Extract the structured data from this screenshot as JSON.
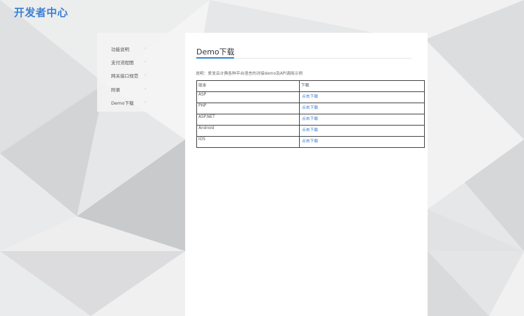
{
  "brand": {
    "title": "开发者中心"
  },
  "sidebar": {
    "items": [
      {
        "label": "功能说明",
        "chevron": "›"
      },
      {
        "label": "支付流程图",
        "chevron": "›"
      },
      {
        "label": "网关接口规范",
        "chevron": "›"
      },
      {
        "label": "附录",
        "chevron": "›"
      },
      {
        "label": "Demo下载",
        "chevron": "›"
      }
    ]
  },
  "main": {
    "title": "Demo下载",
    "description": "说明：爱发云计费各种平台语言的对接demo及API调用示例",
    "table": {
      "headers": [
        "版本",
        "下载"
      ],
      "rows": [
        {
          "version": "ASP",
          "link": "点击下载"
        },
        {
          "version": "PHP",
          "link": "点击下载"
        },
        {
          "version": "ASP.NET",
          "link": "点击下载"
        },
        {
          "version": "Android",
          "link": "点击下载"
        },
        {
          "version": "IOS",
          "link": "点击下载"
        }
      ]
    }
  },
  "colors": {
    "brand": "#3a7fd5",
    "accent": "#2f86d1",
    "link": "#3b7fd1"
  }
}
